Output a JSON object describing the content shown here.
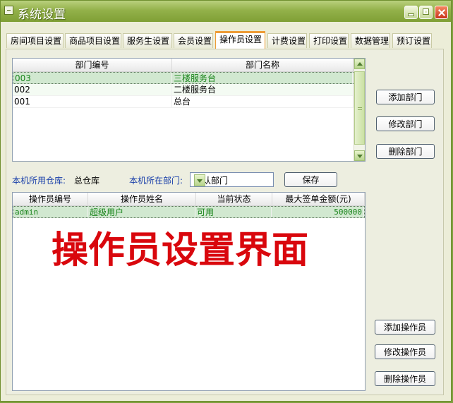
{
  "window": {
    "title": "系统设置"
  },
  "tabs": [
    "房间项目设置",
    "商品项目设置",
    "服务生设置",
    "会员设置",
    "操作员设置",
    "计费设置",
    "打印设置",
    "数据管理",
    "预订设置"
  ],
  "departments": {
    "headers": [
      "部门编号",
      "部门名称"
    ],
    "rows": [
      {
        "id": "003",
        "name": "三楼服务台"
      },
      {
        "id": "002",
        "name": "二楼服务台"
      },
      {
        "id": "001",
        "name": "总台"
      }
    ]
  },
  "buttons": {
    "add_department": "添加部门",
    "edit_department": "修改部门",
    "delete_department": "删除部门",
    "save": "保存",
    "add_operator": "添加操作员",
    "edit_operator": "修改操作员",
    "delete_operator": "删除操作员"
  },
  "settings": {
    "warehouse_label": "本机所用仓库:",
    "warehouse_value": "总仓库",
    "department_label": "本机所在部门:",
    "department_value": "默认部门"
  },
  "operators": {
    "headers": [
      "操作员编号",
      "操作员姓名",
      "当前状态",
      "最大签单金额(元)"
    ],
    "rows": [
      {
        "id": "admin",
        "name": "超级用户",
        "status": "可用",
        "limit": "500000"
      }
    ]
  },
  "overlay_text": "操作员设置界面"
}
